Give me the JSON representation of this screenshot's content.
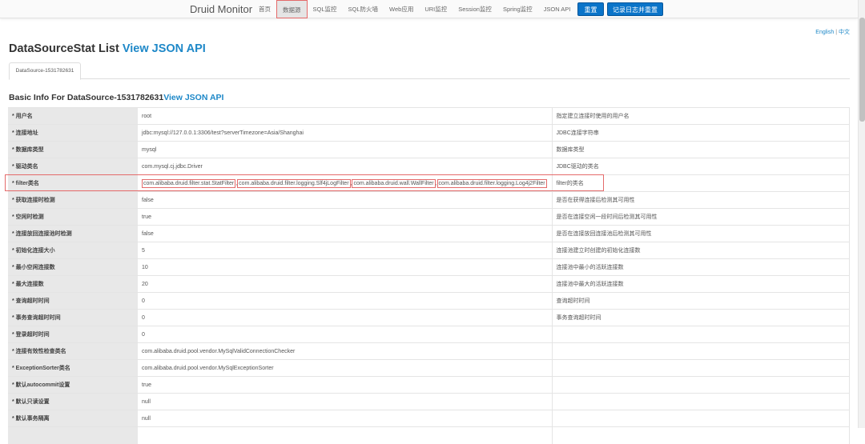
{
  "nav": {
    "brand": "Druid Monitor",
    "items": [
      "首页",
      "数据源",
      "SQL监控",
      "SQL防火墙",
      "Web应用",
      "URI监控",
      "Session监控",
      "Spring监控",
      "JSON API"
    ],
    "active_index": 1,
    "reset": "重置",
    "log_reset": "记录日志并重置"
  },
  "lang": {
    "english": "English",
    "sep": "|",
    "chinese": "中文"
  },
  "title": {
    "text": "DataSourceStat List ",
    "link": "View JSON API"
  },
  "tab": "DataSource-1531782631",
  "section": {
    "text": "Basic Info For DataSource-1531782631",
    "link": "View JSON API"
  },
  "rows": [
    {
      "k": "* 用户名",
      "v": "root",
      "d": "指定建立连接时使用的用户名"
    },
    {
      "k": "* 连接地址",
      "v": "jdbc:mysql://127.0.0.1:3306/test?serverTimezone=Asia/Shanghai",
      "d": "JDBC连接字符串"
    },
    {
      "k": "* 数据库类型",
      "v": "mysql",
      "d": "数据库类型"
    },
    {
      "k": "* 驱动类名",
      "v": "com.mysql.cj.jdbc.Driver",
      "d": "JDBC驱动的类名"
    },
    {
      "k": "* filter类名",
      "filters": [
        "com.alibaba.druid.filter.stat.StatFilter",
        "com.alibaba.druid.filter.logging.Slf4jLogFilter",
        "com.alibaba.druid.wall.WallFilter",
        "com.alibaba.druid.filter.logging.Log4j2Filter"
      ],
      "sep": ",",
      "d": "filter的类名"
    },
    {
      "k": "* 获取连接时检测",
      "v": "false",
      "d": "是否在获得连接后检测其可用性"
    },
    {
      "k": "* 空闲时检测",
      "v": "true",
      "d": "是否在连接空闲一段时间后检测其可用性"
    },
    {
      "k": "* 连接放回连接池时检测",
      "v": "false",
      "d": "是否在连接放回连接池后检测其可用性"
    },
    {
      "k": "* 初始化连接大小",
      "v": "5",
      "d": "连接池建立时创建的初始化连接数"
    },
    {
      "k": "* 最小空闲连接数",
      "v": "10",
      "d": "连接池中最小的活跃连接数"
    },
    {
      "k": "* 最大连接数",
      "v": "20",
      "d": "连接池中最大的活跃连接数"
    },
    {
      "k": "* 查询超时时间",
      "v": "0",
      "d": "查询超时时间"
    },
    {
      "k": "* 事务查询超时时间",
      "v": "0",
      "d": "事务查询超时时间"
    },
    {
      "k": "* 登录超时时间",
      "v": "0",
      "d": ""
    },
    {
      "k": "* 连接有效性检查类名",
      "v": "com.alibaba.druid.pool.vendor.MySqlValidConnectionChecker",
      "d": ""
    },
    {
      "k": "* ExceptionSorter类名",
      "v": "com.alibaba.druid.pool.vendor.MySqlExceptionSorter",
      "d": ""
    },
    {
      "k": "* 默认autocommit设置",
      "v": "true",
      "d": ""
    },
    {
      "k": "* 默认只读设置",
      "v": "null",
      "d": ""
    },
    {
      "k": "* 默认事务隔离",
      "v": "null",
      "d": ""
    },
    {
      "k": "",
      "v": "",
      "d": ""
    }
  ],
  "colors": {
    "accent": "#1e88c8",
    "button": "#0a74c9",
    "highlight": "#e46a6a"
  }
}
